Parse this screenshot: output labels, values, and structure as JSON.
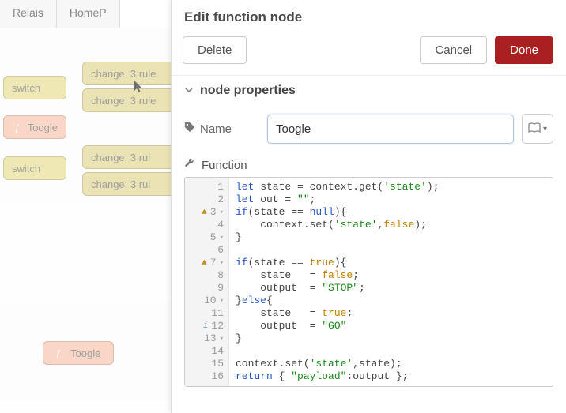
{
  "tabs": {
    "relais": "Relais",
    "homep": "HomeP"
  },
  "flow": {
    "switch1": "switch",
    "switch2": "switch",
    "toogle1": "Toogle",
    "toogle2": "Toogle",
    "change1": "change: 3 rule",
    "change2": "change: 3 rule",
    "change3": "change: 3 rul",
    "change4": "change: 3 rul"
  },
  "drawer": {
    "title": "Edit function node",
    "delete_label": "Delete",
    "cancel_label": "Cancel",
    "done_label": "Done",
    "section_title": "node properties",
    "name_label": "Name",
    "name_value": "Toogle",
    "function_label": "Function"
  },
  "editor": {
    "gutter": [
      "1",
      "2",
      "3",
      "4",
      "5",
      "6",
      "7",
      "8",
      "9",
      "10",
      "11",
      "12",
      "13",
      "14",
      "15",
      "16"
    ],
    "warn_lines": [
      3,
      7
    ],
    "info_lines": [
      12
    ],
    "fold_lines": [
      3,
      5,
      7,
      10,
      13
    ],
    "code_plain": "let state = context.get('state');\nlet out = \"\";\nif(state == null){\n    context.set('state',false);\n}\n\nif(state == true){\n    state   = false;\n    output  = \"STOP\";\n}else{\n    state   = true;\n    output  = \"GO\"\n}\n\ncontext.set('state',state);\nreturn { \"payload\":output };"
  }
}
